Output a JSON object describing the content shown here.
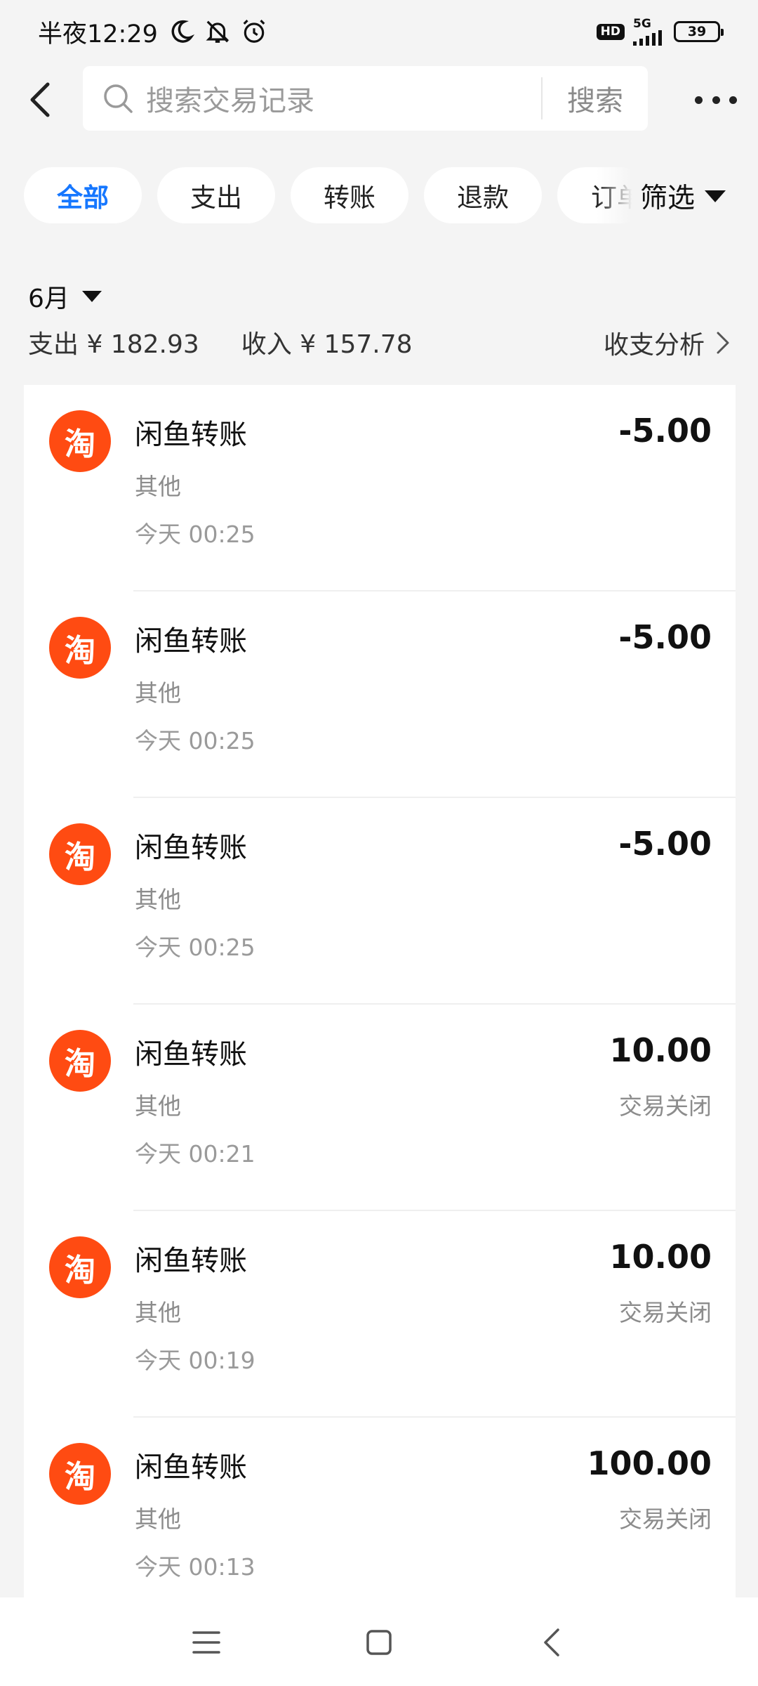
{
  "status_bar": {
    "time": "半夜12:29",
    "hd": "HD",
    "network": "5G",
    "battery": "39"
  },
  "header": {
    "search_placeholder": "搜索交易记录",
    "search_button": "搜索"
  },
  "filters": {
    "chips": [
      "全部",
      "支出",
      "转账",
      "退款",
      "订单"
    ],
    "active": "全部",
    "filter_label": "筛选"
  },
  "summary": {
    "month": "6月",
    "expense": "支出 ¥ 182.93",
    "income": "收入 ¥ 157.78",
    "analysis": "收支分析"
  },
  "transactions": [
    {
      "logo": "淘",
      "title": "闲鱼转账",
      "category": "其他",
      "time": "今天 00:25",
      "amount": "-5.00",
      "status": ""
    },
    {
      "logo": "淘",
      "title": "闲鱼转账",
      "category": "其他",
      "time": "今天 00:25",
      "amount": "-5.00",
      "status": ""
    },
    {
      "logo": "淘",
      "title": "闲鱼转账",
      "category": "其他",
      "time": "今天 00:25",
      "amount": "-5.00",
      "status": ""
    },
    {
      "logo": "淘",
      "title": "闲鱼转账",
      "category": "其他",
      "time": "今天 00:21",
      "amount": "10.00",
      "status": "交易关闭"
    },
    {
      "logo": "淘",
      "title": "闲鱼转账",
      "category": "其他",
      "time": "今天 00:19",
      "amount": "10.00",
      "status": "交易关闭"
    },
    {
      "logo": "淘",
      "title": "闲鱼转账",
      "category": "其他",
      "time": "今天 00:13",
      "amount": "100.00",
      "status": "交易关闭"
    }
  ],
  "colors": {
    "accent": "#1677ff",
    "logo_bg": "#ff4b12",
    "background": "#f4f4f4"
  },
  "icons": [
    "moon-icon",
    "bell-off-icon",
    "alarm-icon",
    "signal-icon",
    "battery-icon",
    "back-icon",
    "search-icon",
    "more-icon",
    "caret-down-icon",
    "chevron-right-icon",
    "menu-icon",
    "home-icon",
    "nav-back-icon"
  ]
}
